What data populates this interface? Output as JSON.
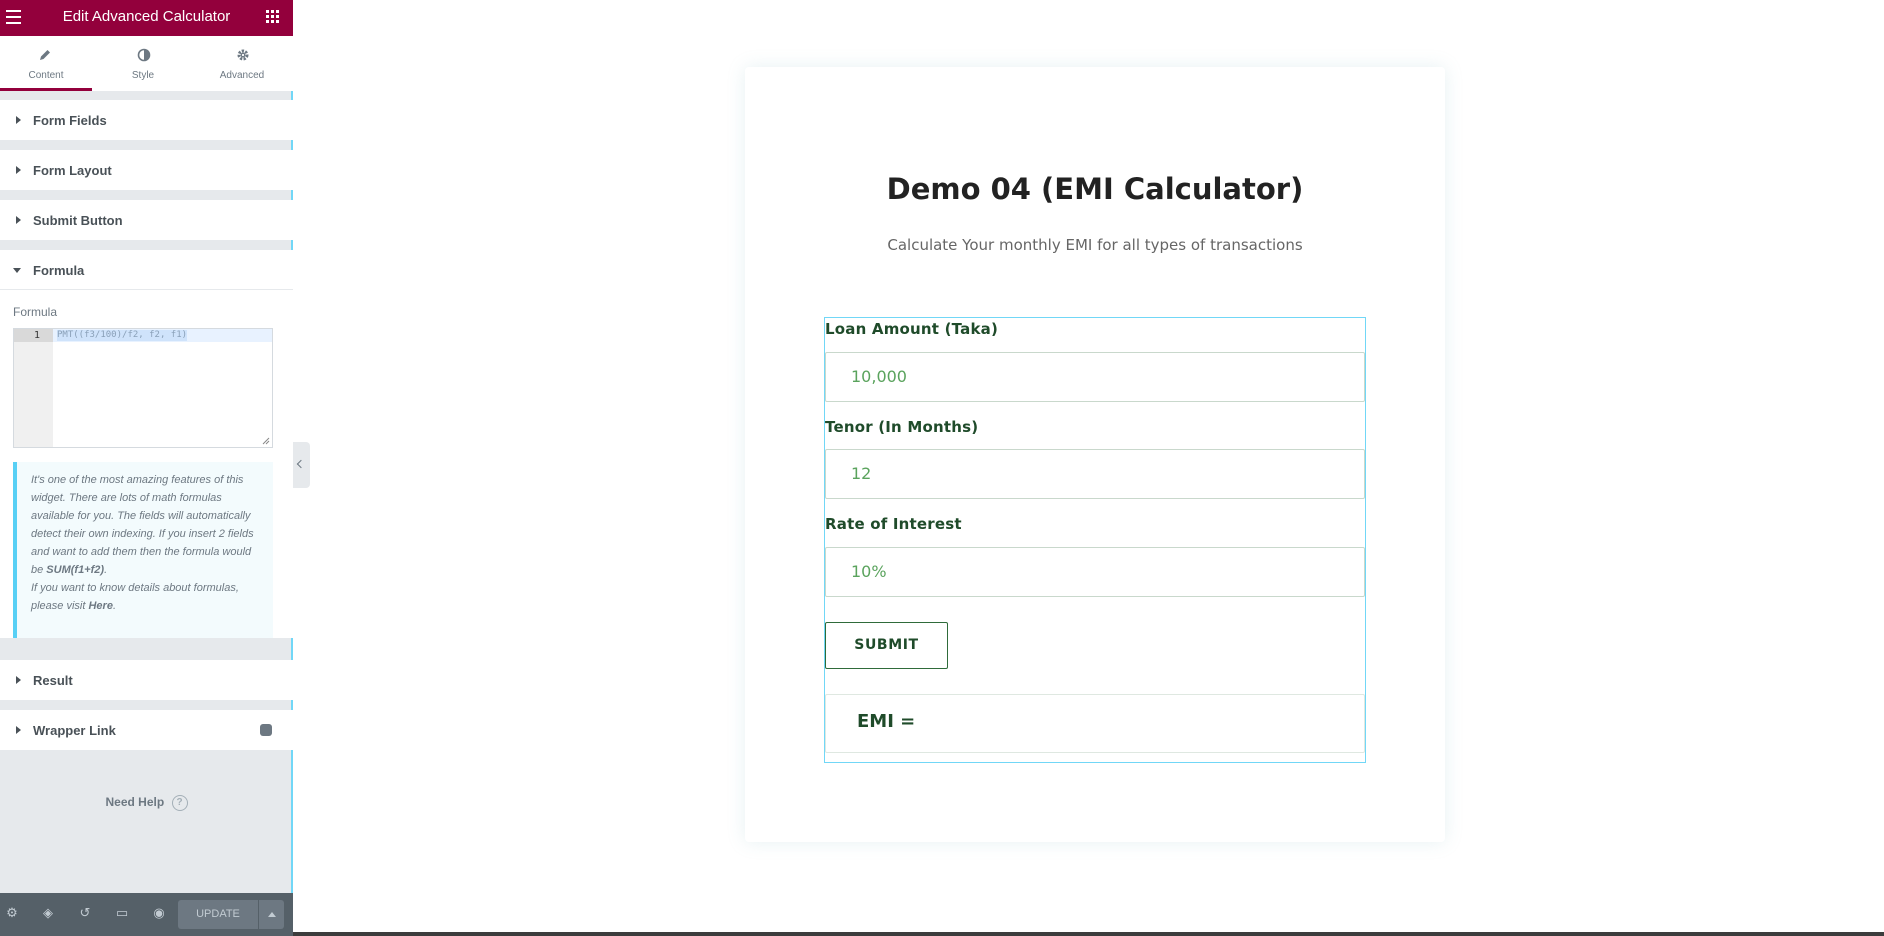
{
  "editor": {
    "title": "Edit Advanced Calculator",
    "tabs": [
      {
        "label": "Content",
        "icon": "pencil-icon"
      },
      {
        "label": "Style",
        "icon": "half-circle-icon"
      },
      {
        "label": "Advanced",
        "icon": "gear-icon"
      }
    ],
    "sections": {
      "form_fields": "Form Fields",
      "form_layout": "Form Layout",
      "submit_button": "Submit Button",
      "formula": "Formula",
      "result": "Result",
      "wrapper_link": "Wrapper Link"
    },
    "formula_field": {
      "label": "Formula",
      "line_number": "1",
      "code": "PMT((f3/100)/f2, f2, f1)"
    },
    "info": {
      "text1": "It's one of the most amazing features of this widget. There are lots of math formulas available for you. The fields will automatically detect their own indexing. If you insert 2 fields and want to add them then the formula would be ",
      "bold": "SUM(f1+f2)",
      "text2": ".",
      "text3": "If you want to know details about formulas, please visit ",
      "link": "Here",
      "text4": "."
    },
    "need_help": "Need Help",
    "update_label": "UPDATE"
  },
  "calculator": {
    "heading": "Demo 04 (EMI Calculator)",
    "subheading": "Calculate Your monthly EMI for all types of transactions",
    "fields": [
      {
        "label": "Loan Amount (Taka)",
        "value": "10,000"
      },
      {
        "label": "Tenor (In Months)",
        "value": "12"
      },
      {
        "label": "Rate of Interest",
        "value": "10%"
      }
    ],
    "submit_label": "SUBMIT",
    "result_label": "EMI ="
  },
  "colors": {
    "brand": "#93003c",
    "accent": "#71d7f7",
    "field_text": "#5aa35d",
    "label_text": "#1f4b2a"
  }
}
